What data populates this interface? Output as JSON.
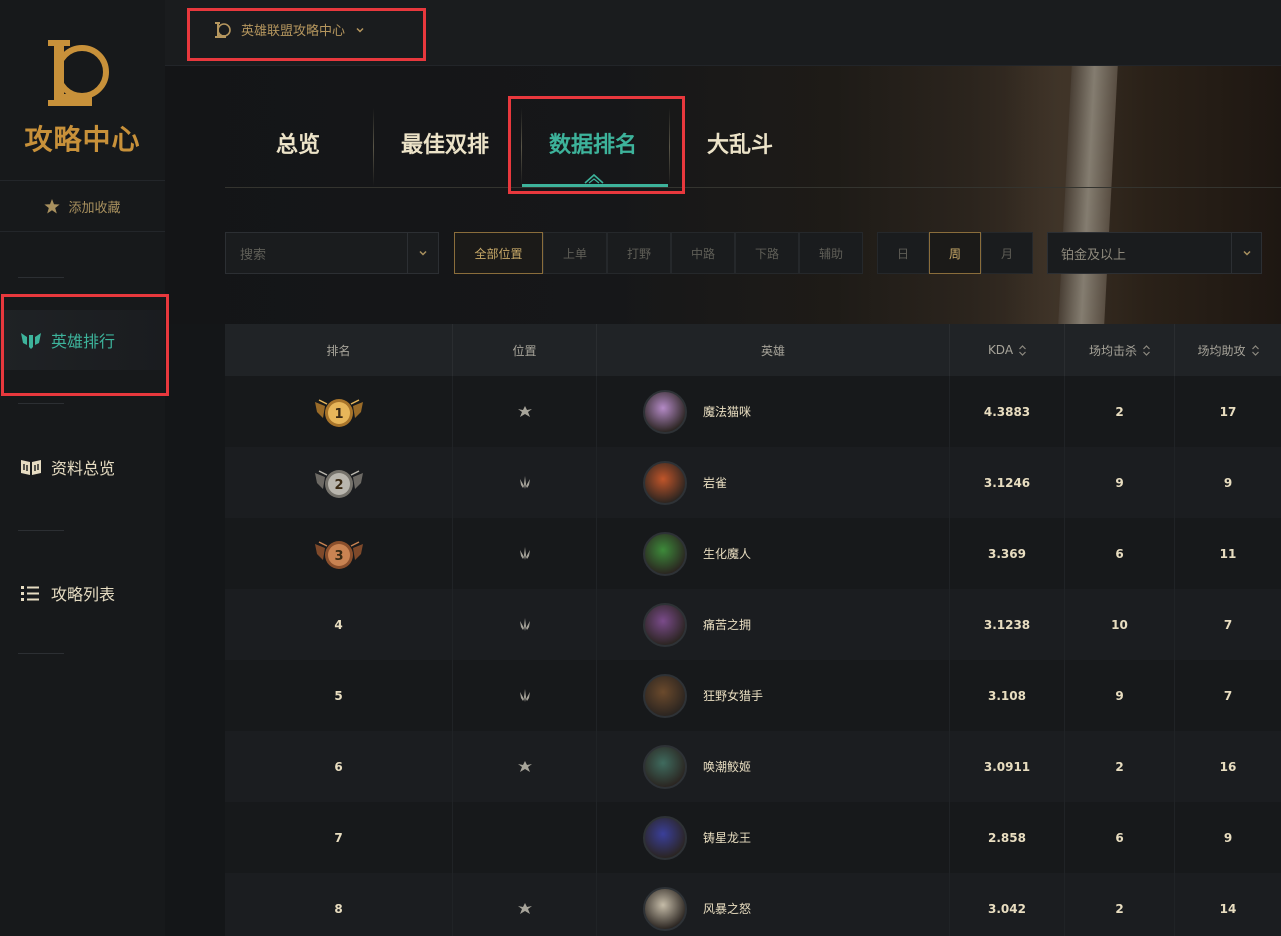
{
  "sidebar": {
    "logo_text": "攻略中心",
    "favorite_label": "添加收藏",
    "items": [
      {
        "label": "英雄排行",
        "icon": "shield-wings-icon",
        "active": true
      },
      {
        "label": "资料总览",
        "icon": "book-icon",
        "active": false
      },
      {
        "label": "攻略列表",
        "icon": "list-icon",
        "active": false
      }
    ]
  },
  "header": {
    "breadcrumb": "英雄联盟攻略中心"
  },
  "tabs": [
    {
      "label": "总览",
      "active": false
    },
    {
      "label": "最佳双排",
      "active": false
    },
    {
      "label": "数据排名",
      "active": true
    },
    {
      "label": "大乱斗",
      "active": false
    }
  ],
  "filters": {
    "search_placeholder": "搜索",
    "positions": [
      "全部位置",
      "上单",
      "打野",
      "中路",
      "下路",
      "辅助"
    ],
    "position_selected": "全部位置",
    "periods": [
      "日",
      "周",
      "月"
    ],
    "period_selected": "周",
    "tier_value": "铂金及以上"
  },
  "table": {
    "columns": [
      "排名",
      "位置",
      "英雄",
      "KDA",
      "场均击杀",
      "场均助攻"
    ],
    "rows": [
      {
        "rank": "1",
        "position": "support",
        "hero": "魔法猫咪",
        "kda": "4.3883",
        "kills": "2",
        "assists": "17"
      },
      {
        "rank": "2",
        "position": "jungle",
        "hero": "岩雀",
        "kda": "3.1246",
        "kills": "9",
        "assists": "9"
      },
      {
        "rank": "3",
        "position": "jungle",
        "hero": "生化魔人",
        "kda": "3.369",
        "kills": "6",
        "assists": "11"
      },
      {
        "rank": "4",
        "position": "jungle",
        "hero": "痛苦之拥",
        "kda": "3.1238",
        "kills": "10",
        "assists": "7"
      },
      {
        "rank": "5",
        "position": "jungle",
        "hero": "狂野女猎手",
        "kda": "3.108",
        "kills": "9",
        "assists": "7"
      },
      {
        "rank": "6",
        "position": "support",
        "hero": "唤潮鲛姬",
        "kda": "3.0911",
        "kills": "2",
        "assists": "16"
      },
      {
        "rank": "7",
        "position": "none",
        "hero": "铸星龙王",
        "kda": "2.858",
        "kills": "6",
        "assists": "9"
      },
      {
        "rank": "8",
        "position": "support",
        "hero": "风暴之怒",
        "kda": "3.042",
        "kills": "2",
        "assists": "14"
      }
    ]
  },
  "colors": {
    "accent_gold": "#c8913a",
    "accent_teal": "#3db39b",
    "highlight_red": "#e8383d"
  }
}
